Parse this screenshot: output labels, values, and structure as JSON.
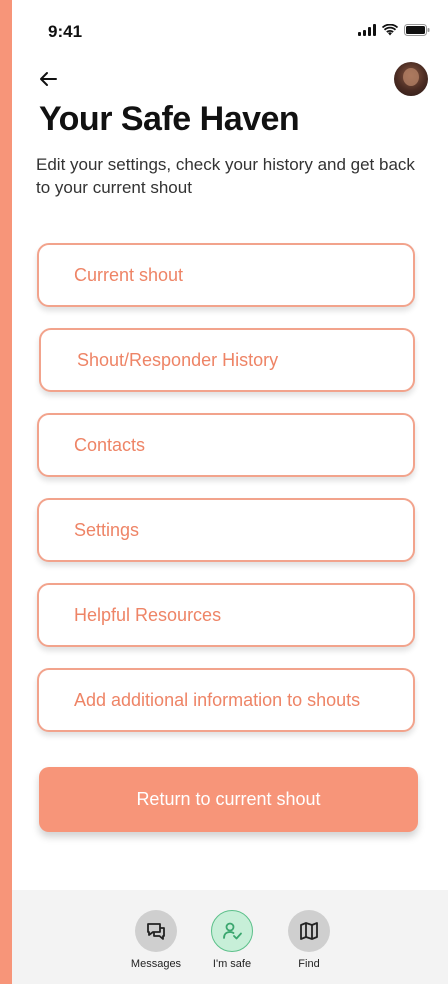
{
  "status_bar": {
    "time": "9:41"
  },
  "header": {
    "title": "Your Safe Haven",
    "subtitle": "Edit your settings, check your history and get back to your current shout"
  },
  "menu": {
    "items": [
      {
        "label": "Current shout"
      },
      {
        "label": "Shout/Responder History"
      },
      {
        "label": "Contacts"
      },
      {
        "label": "Settings"
      },
      {
        "label": "Helpful Resources"
      },
      {
        "label": "Add additional information to shouts"
      }
    ]
  },
  "primary_button": {
    "label": "Return to current shout"
  },
  "bottom_nav": {
    "items": [
      {
        "label": "Messages",
        "icon": "messages-icon"
      },
      {
        "label": "I'm safe",
        "icon": "person-check-icon",
        "active": true
      },
      {
        "label": "Find",
        "icon": "map-icon"
      }
    ]
  },
  "colors": {
    "accent": "#f79579",
    "accent_text": "#ee8466",
    "safe_active": "#c7efd8"
  }
}
